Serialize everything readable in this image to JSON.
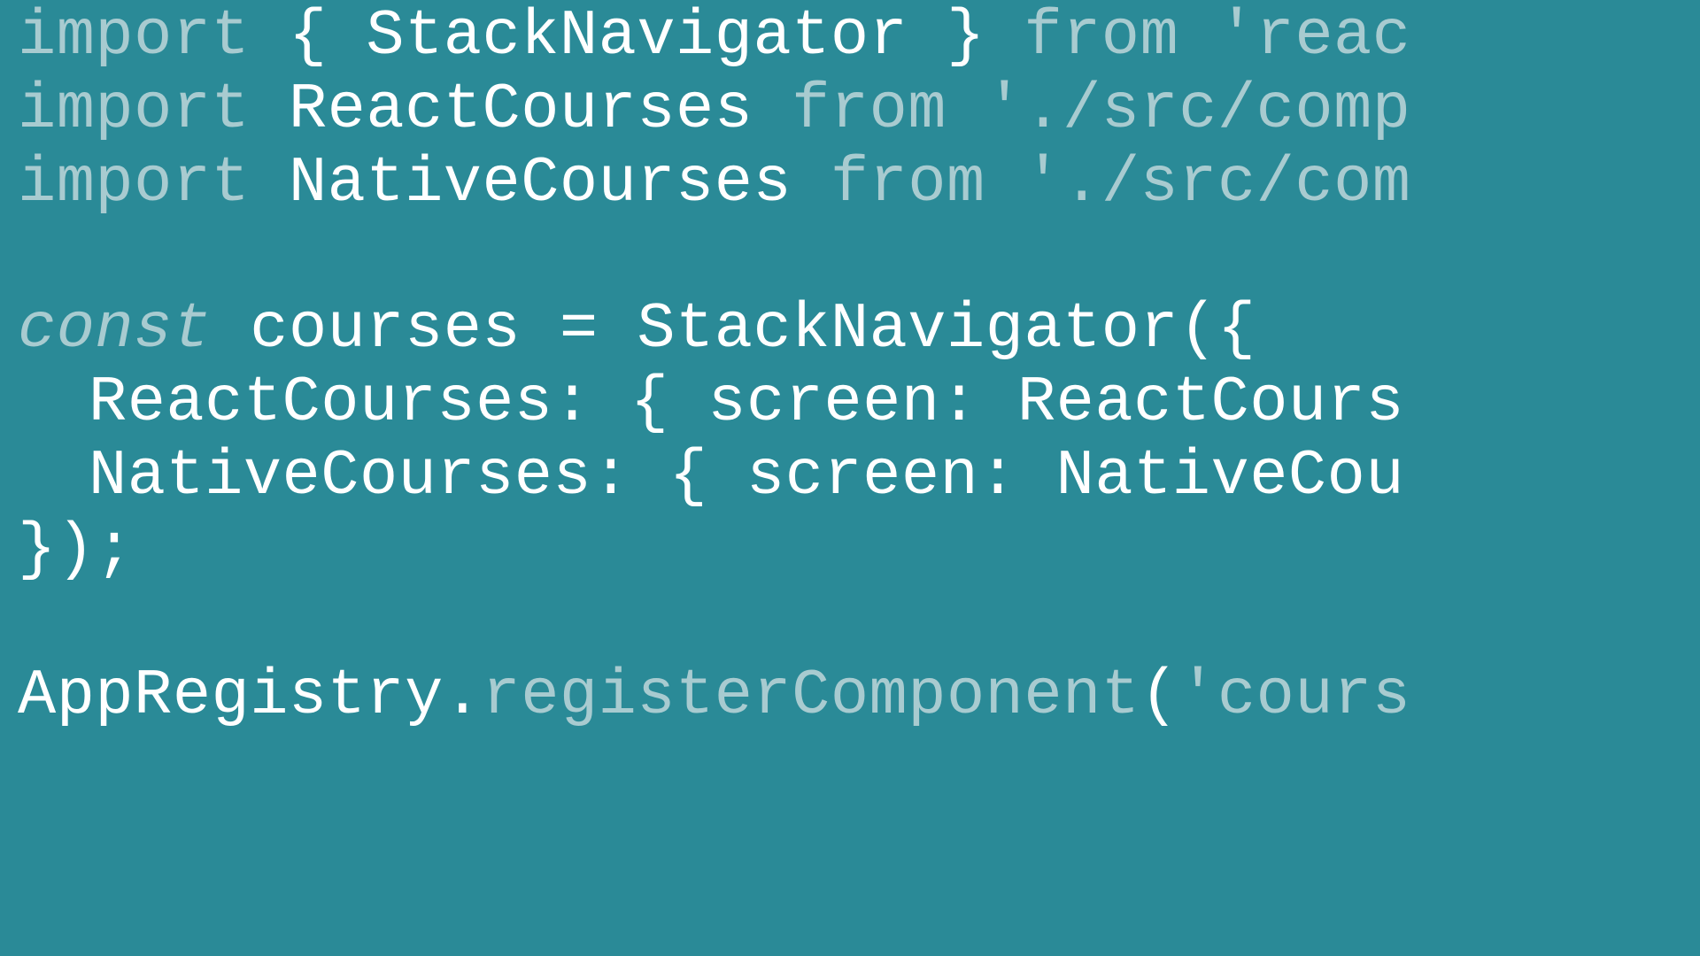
{
  "code": {
    "line1": {
      "keyword1": "import",
      "text1": " { StackNavigator } ",
      "keyword2": "from ",
      "string1": "'reac"
    },
    "line2": {
      "keyword1": "import",
      "text1": " ReactCourses ",
      "keyword2": "from ",
      "string1": "'./src/comp"
    },
    "line3": {
      "keyword1": "import",
      "text1": " NativeCourses ",
      "keyword2": "from ",
      "string1": "'./src/com"
    },
    "line4": "",
    "line5": {
      "keyword1": "const",
      "text1": " courses = StackNavigator({"
    },
    "line6": {
      "text1": "ReactCourses: { screen: ReactCours"
    },
    "line7": {
      "text1": "NativeCourses: { screen: NativeCou"
    },
    "line8": {
      "text1": "});"
    },
    "line9": "",
    "line10": {
      "text1": "AppRegistry.",
      "method1": "registerComponent",
      "text2": "(",
      "string1": "'cours"
    }
  },
  "colors": {
    "background": "#2a8a97",
    "keyword": "#a8cbd0",
    "default": "#ffffff",
    "string": "#a8cbd0"
  }
}
